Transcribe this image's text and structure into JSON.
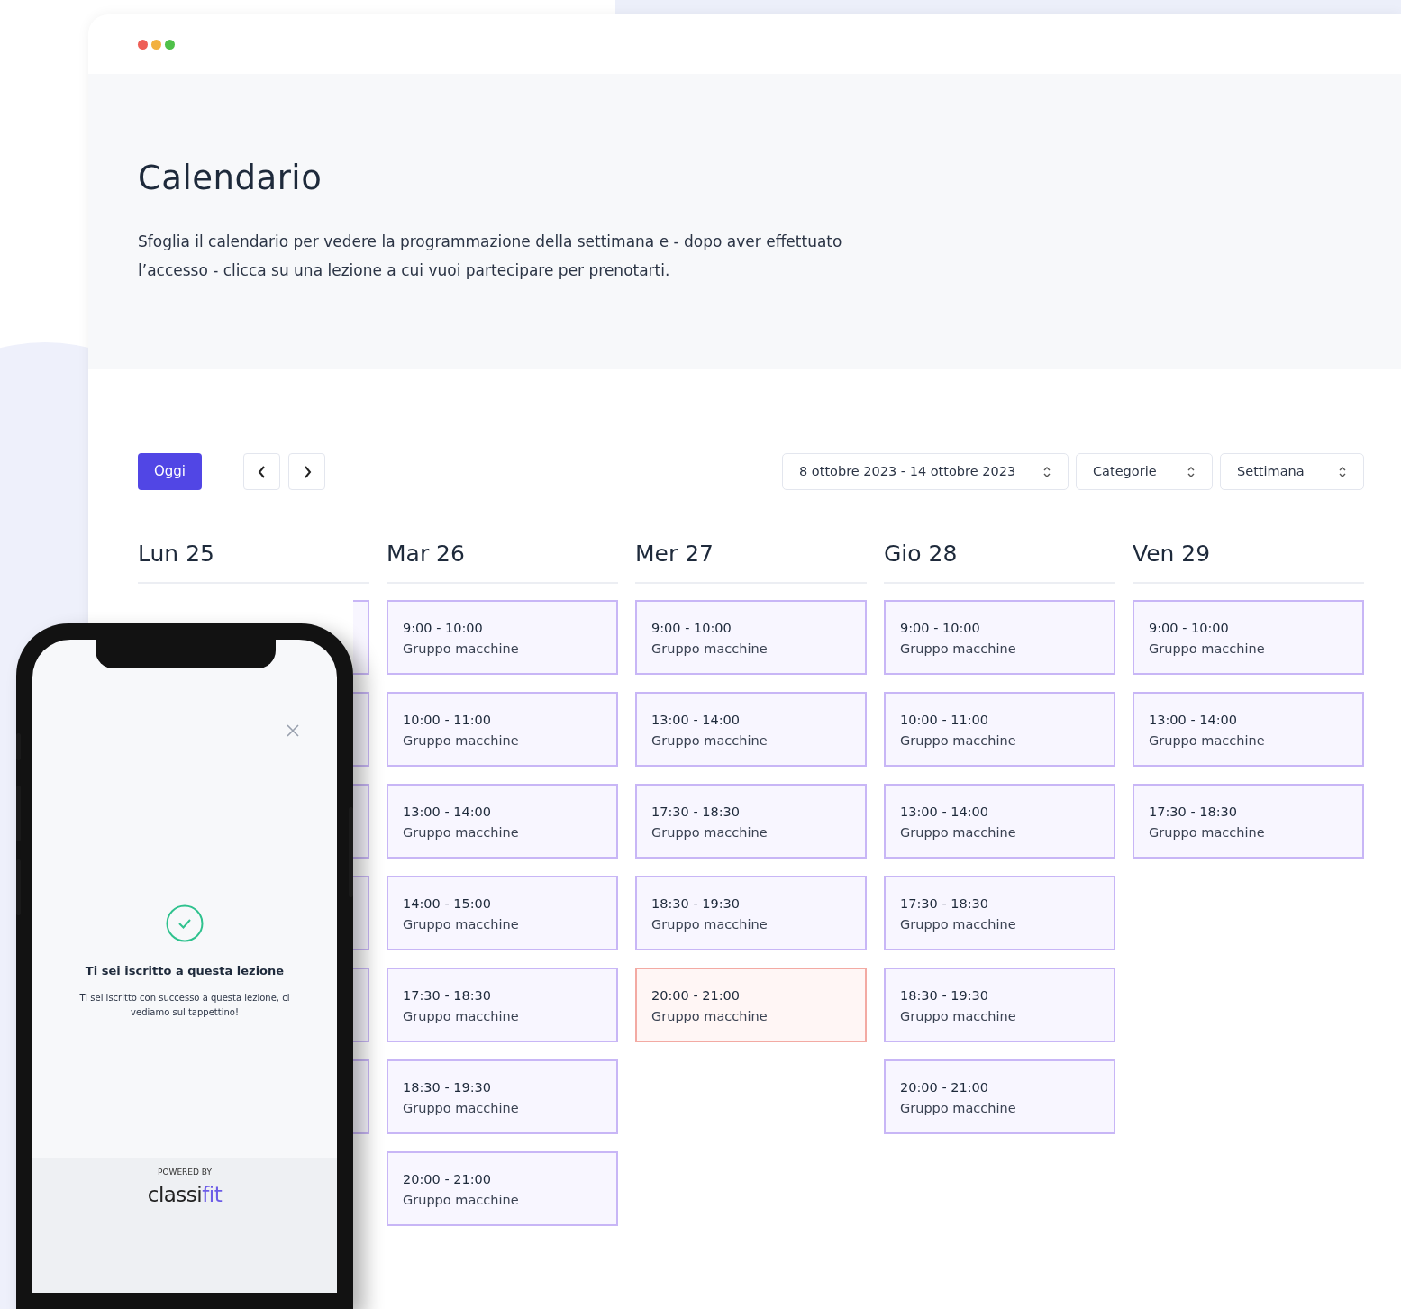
{
  "window": {
    "controls": [
      {
        "color": "#ee5f57"
      },
      {
        "color": "#f2b13f"
      },
      {
        "color": "#4fc149"
      }
    ]
  },
  "header": {
    "title": "Calendario",
    "description": "Sfoglia il calendario per vedere la programmazione della settimana e - dopo aver effettuato l’accesso - clicca su una lezione a cui vuoi partecipare per prenotarti."
  },
  "toolbar": {
    "today_button": "Oggi",
    "selects": [
      {
        "value": "8 ottobre 2023 - 14 ottobre 2023"
      },
      {
        "value": "Categorie"
      },
      {
        "value": "Settimana"
      }
    ]
  },
  "days": [
    {
      "label": "Lun 25",
      "events": [
        {
          "highlighted": false
        },
        {
          "highlighted": false
        },
        {
          "highlighted": false
        },
        {
          "highlighted": false
        },
        {
          "highlighted": false
        },
        {
          "highlighted": false
        }
      ]
    },
    {
      "label": "Mar 26",
      "events": [
        {
          "time": "9:00 - 10:00",
          "title": "Gruppo macchine",
          "highlighted": false
        },
        {
          "time": "10:00 - 11:00",
          "title": "Gruppo macchine",
          "highlighted": false
        },
        {
          "time": "13:00 - 14:00",
          "title": "Gruppo macchine",
          "highlighted": false
        },
        {
          "time": "14:00 - 15:00",
          "title": "Gruppo macchine",
          "highlighted": false
        },
        {
          "time": "17:30 - 18:30",
          "title": "Gruppo macchine",
          "highlighted": false
        },
        {
          "time": "18:30 - 19:30",
          "title": "Gruppo macchine",
          "highlighted": false
        },
        {
          "time": "20:00 - 21:00",
          "title": "Gruppo macchine",
          "highlighted": false
        }
      ]
    },
    {
      "label": "Mer 27",
      "events": [
        {
          "time": "9:00 - 10:00",
          "title": "Gruppo macchine",
          "highlighted": false
        },
        {
          "time": "13:00 - 14:00",
          "title": "Gruppo macchine",
          "highlighted": false
        },
        {
          "time": "17:30 - 18:30",
          "title": "Gruppo macchine",
          "highlighted": false
        },
        {
          "time": "18:30 - 19:30",
          "title": "Gruppo macchine",
          "highlighted": false
        },
        {
          "time": "20:00 - 21:00",
          "title": "Gruppo macchine",
          "highlighted": true
        }
      ]
    },
    {
      "label": "Gio 28",
      "events": [
        {
          "time": "9:00 - 10:00",
          "title": "Gruppo macchine",
          "highlighted": false
        },
        {
          "time": "10:00 - 11:00",
          "title": "Gruppo macchine",
          "highlighted": false
        },
        {
          "time": "13:00 - 14:00",
          "title": "Gruppo macchine",
          "highlighted": false
        },
        {
          "time": "17:30 - 18:30",
          "title": "Gruppo macchine",
          "highlighted": false
        },
        {
          "time": "18:30 - 19:30",
          "title": "Gruppo macchine",
          "highlighted": false
        },
        {
          "time": "20:00 - 21:00",
          "title": "Gruppo macchine",
          "highlighted": false
        }
      ]
    },
    {
      "label": "Ven 29",
      "events": [
        {
          "time": "9:00 - 10:00",
          "title": "Gruppo macchine",
          "highlighted": false
        },
        {
          "time": "13:00 - 14:00",
          "title": "Gruppo macchine",
          "highlighted": false
        },
        {
          "time": "17:30 - 18:30",
          "title": "Gruppo macchine",
          "highlighted": false
        }
      ]
    }
  ],
  "phone": {
    "title": "Ti sei iscritto a questa lezione",
    "message": "Ti sei iscritto con successo a questa lezione, ci vediamo sul tappettino!",
    "footer_label": "POWERED BY",
    "logo": {
      "main": "classi",
      "accent": "fit"
    }
  }
}
